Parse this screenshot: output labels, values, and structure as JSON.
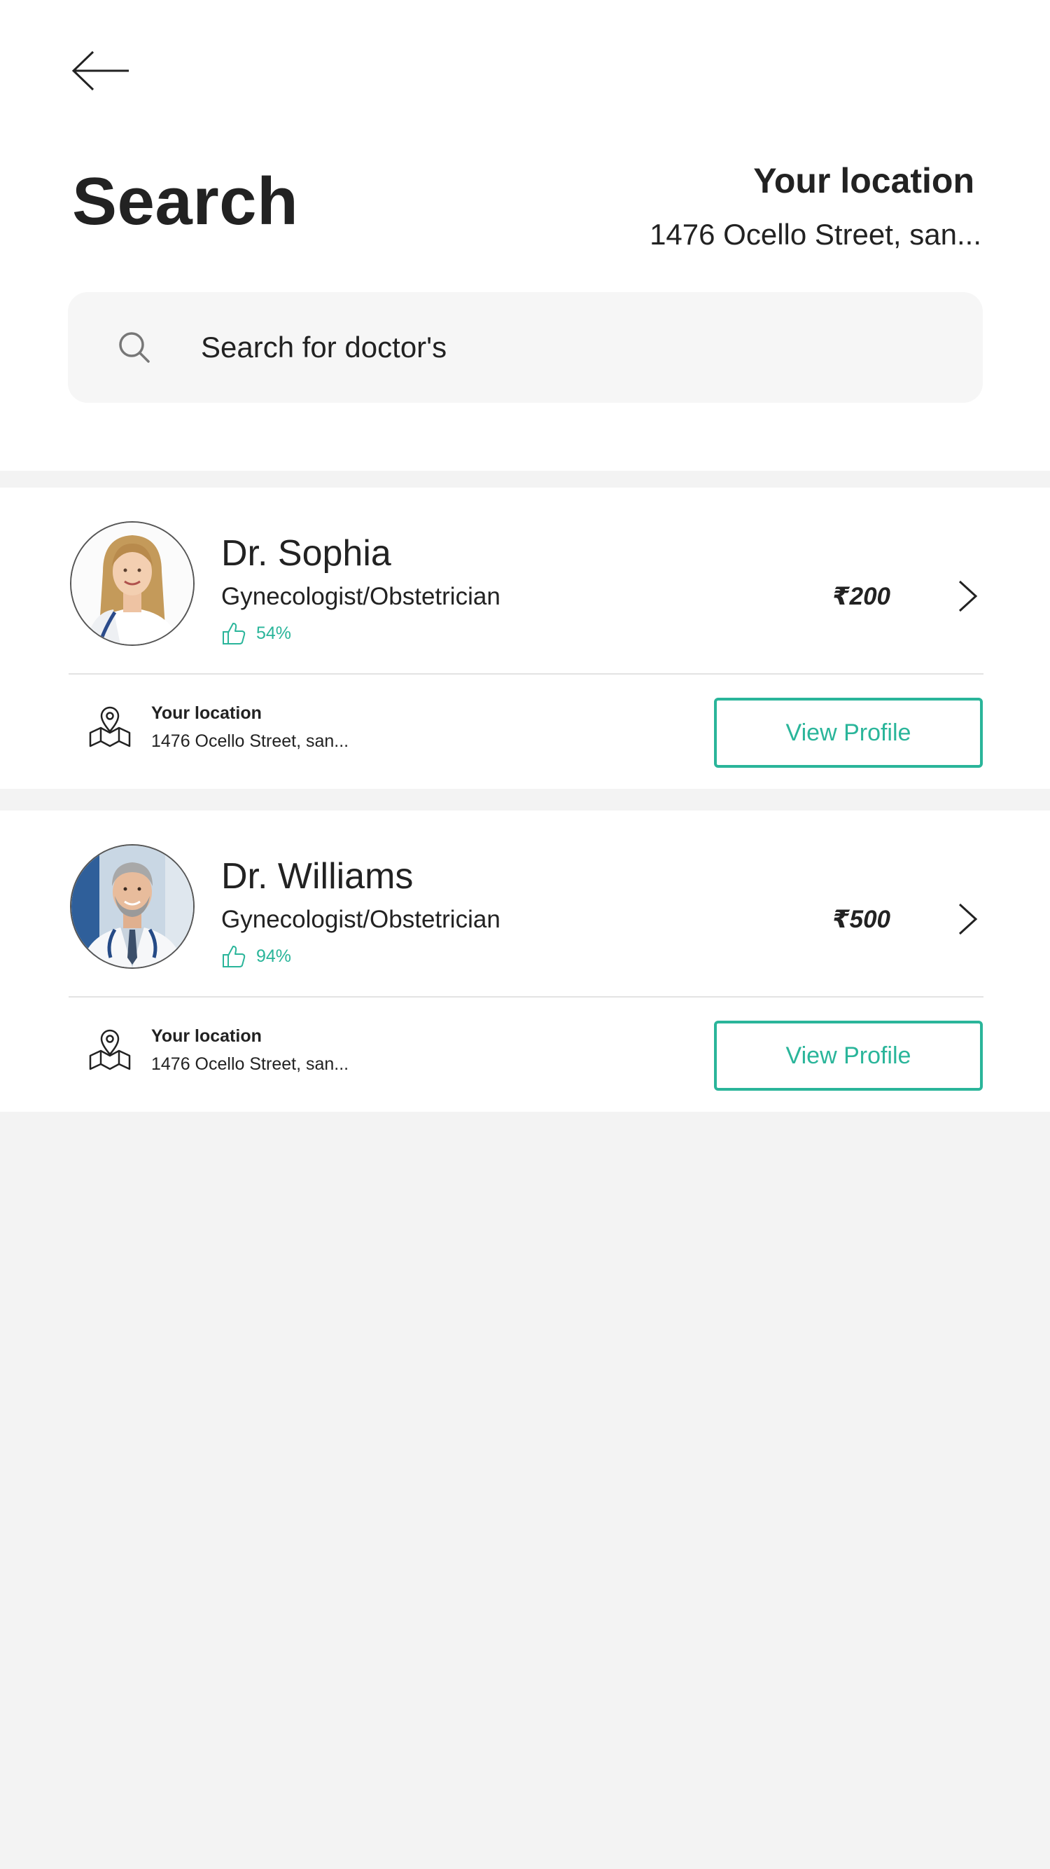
{
  "header": {
    "title": "Search",
    "location_title": "Your location",
    "location_address": "1476 Ocello Street, san..."
  },
  "search": {
    "placeholder": "Search for doctor's",
    "value": ""
  },
  "doctors": [
    {
      "name": "Dr. Sophia",
      "specialty": "Gynecologist/Obstetrician",
      "rating": "54%",
      "price": "₹200",
      "location_title": "Your location",
      "location_address": "1476 Ocello Street, san...",
      "button_label": "View Profile"
    },
    {
      "name": "Dr. Williams",
      "specialty": "Gynecologist/Obstetrician",
      "rating": "94%",
      "price": "₹500",
      "location_title": "Your location",
      "location_address": "1476 Ocello Street, san...",
      "button_label": "View Profile"
    }
  ],
  "icons": {
    "back": "back-arrow-icon",
    "search": "search-icon",
    "thumb": "thumbs-up-icon",
    "chevron": "chevron-right-icon",
    "map": "map-pin-icon"
  },
  "colors": {
    "accent": "#2ab59a",
    "text": "#222222",
    "page_background": "#f3f3f3",
    "search_background": "#f6f6f6"
  }
}
